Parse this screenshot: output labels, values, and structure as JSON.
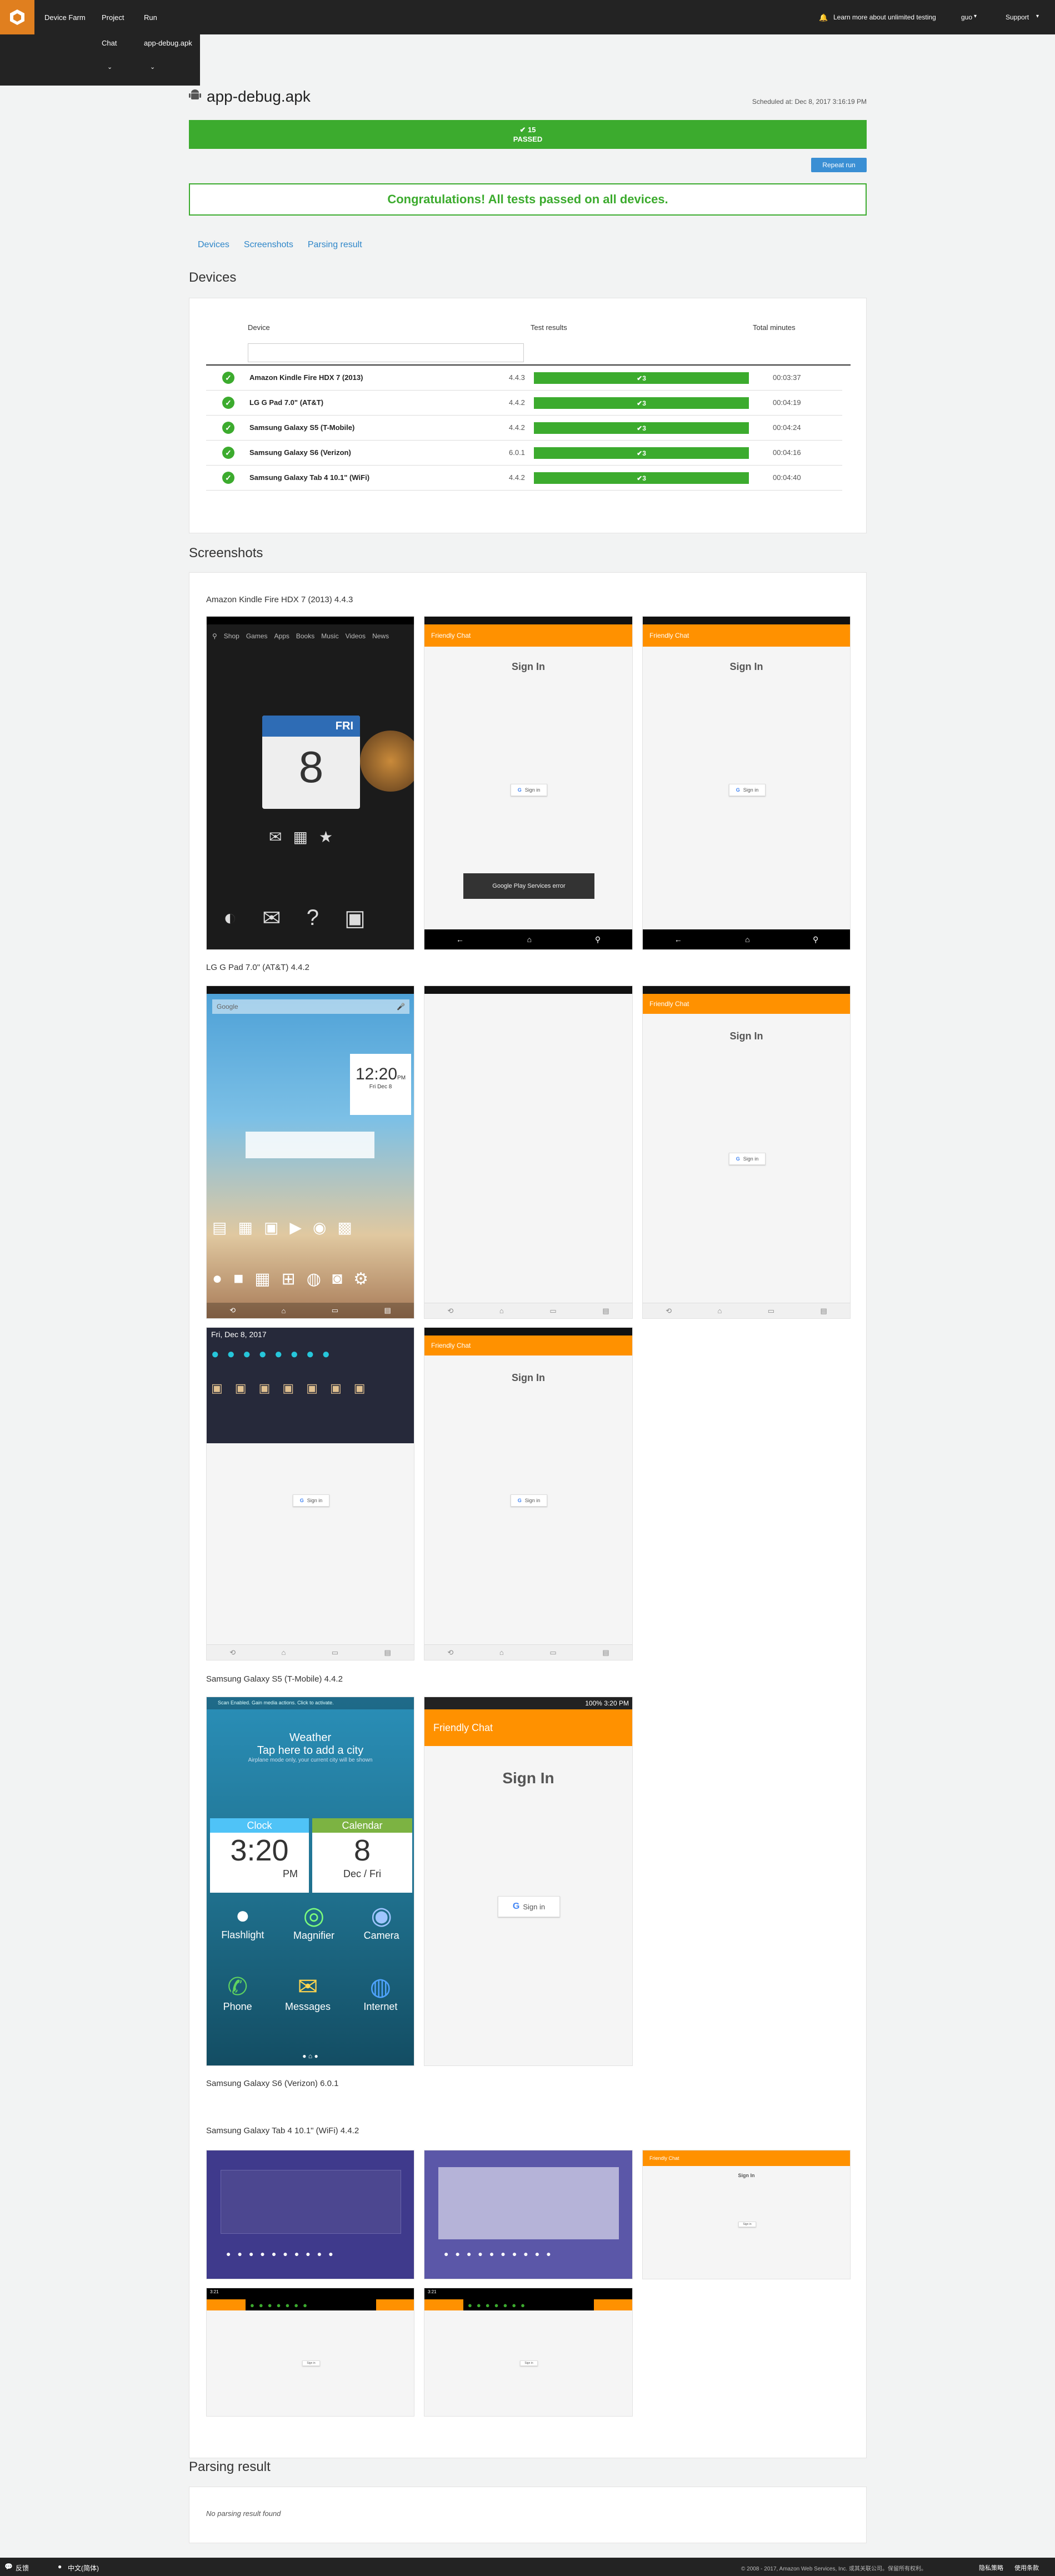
{
  "topbar": {
    "nav": [
      "Device Farm",
      "Project",
      "Run"
    ],
    "subnav": [
      "Chat",
      "app-debug.apk"
    ],
    "subnav_carets": [
      "⌄",
      "⌄"
    ],
    "promo": "Learn more about unlimited testing",
    "user": "guo",
    "support": "Support"
  },
  "run": {
    "title": "app-debug.apk",
    "scheduled": "Scheduled at: Dec 8, 2017 3:16:19 PM",
    "passed_count": "15",
    "passed_label": "PASSED",
    "repeat_label": "Repeat run",
    "congrats": "Congratulations! All tests passed on all devices."
  },
  "tabs": [
    "Devices",
    "Screenshots",
    "Parsing result"
  ],
  "devices_section": {
    "heading": "Devices",
    "columns": [
      "Device",
      "Test results",
      "Total minutes"
    ],
    "rows": [
      {
        "name": "Amazon Kindle Fire HDX 7 (2013)",
        "os": "4.4.3",
        "result": "3",
        "minutes": "00:03:37"
      },
      {
        "name": "LG G Pad 7.0\" (AT&T)",
        "os": "4.4.2",
        "result": "3",
        "minutes": "00:04:19"
      },
      {
        "name": "Samsung Galaxy S5 (T-Mobile)",
        "os": "4.4.2",
        "result": "3",
        "minutes": "00:04:24"
      },
      {
        "name": "Samsung Galaxy S6 (Verizon)",
        "os": "6.0.1",
        "result": "3",
        "minutes": "00:04:16"
      },
      {
        "name": "Samsung Galaxy Tab 4 10.1\" (WiFi)",
        "os": "4.4.2",
        "result": "3",
        "minutes": "00:04:40"
      }
    ]
  },
  "screenshots_section": {
    "heading": "Screenshots",
    "groups": [
      "Amazon Kindle Fire HDX 7 (2013) 4.4.3",
      "LG G Pad 7.0\" (AT&T) 4.4.2",
      "Samsung Galaxy S5 (T-Mobile) 4.4.2",
      "Samsung Galaxy S6 (Verizon) 6.0.1",
      "Samsung Galaxy Tab 4 10.1\" (WiFi) 4.4.2"
    ],
    "app_title": "Friendly Chat",
    "sign_in_heading": "Sign In",
    "sign_in_button": "Sign in",
    "kindle": {
      "menu": [
        "Shop",
        "Games",
        "Apps",
        "Books",
        "Music",
        "Videos",
        "News"
      ],
      "calendar_day": "FRI",
      "calendar_date": "8",
      "toast": "Google Play Services error"
    },
    "lg": {
      "search": "Google",
      "clock": "12:20",
      "clock_suffix": "PM",
      "date": "Fri Dec 8",
      "quick_date": "Fri, Dec 8, 2017"
    },
    "s5": {
      "status_time": "3:20 PM",
      "status_battery": "100%",
      "notice": "Scan Enabled. Gain media actions. Click to activate.",
      "weather_title": "Weather",
      "weather_sub": "Tap here to add a city",
      "weather_note": "Airplane mode only, your current city will be shown",
      "clock_label": "Clock",
      "clock_time": "3:20",
      "clock_ampm": "PM",
      "calendar_label": "Calendar",
      "calendar_date": "8",
      "calendar_sub": "Dec / Fri",
      "apps": [
        "Flashlight",
        "Magnifier",
        "Camera",
        "Phone",
        "Messages",
        "Internet"
      ]
    },
    "tab4": {
      "times": [
        "3:21",
        "3:21"
      ]
    }
  },
  "parsing_section": {
    "heading": "Parsing result",
    "empty": "No parsing result found"
  },
  "footer": {
    "left": [
      "反馈",
      "中文(简体)"
    ],
    "copyright": "© 2008 - 2017, Amazon Web Services, Inc. 或其关联公司。保留所有权利。",
    "links": [
      "隐私策略",
      "使用条款"
    ]
  },
  "colors": {
    "accent": "#3cab2e",
    "brand": "#e07f1f",
    "link": "#2e86c9",
    "app_orange": "#ff9100",
    "topbar": "#232323"
  }
}
